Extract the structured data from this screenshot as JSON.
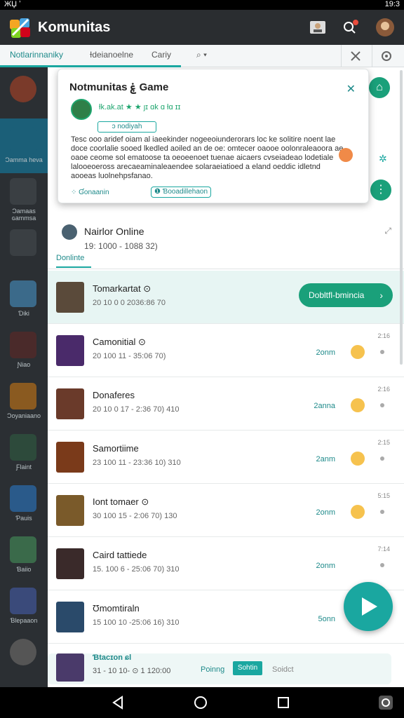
{
  "status_bar": {
    "left": "ЖЏ ʼ",
    "right": "19:3"
  },
  "app": {
    "title": "Komunitas"
  },
  "tabs": {
    "items": [
      "Notlarinnaniky",
      "Ɨdeianoelne",
      "Cariy"
    ]
  },
  "sidebar": {
    "items": [
      {
        "label": "",
        "icon": "community-shield-icon",
        "color": "#7a3a2a"
      },
      {
        "label": "Ɔamma heva",
        "icon": "chat-icon",
        "color": "#1b5f78"
      },
      {
        "label": "Ɔamaas ɢammsa",
        "icon": "headset-icon",
        "color": "#3a3f43"
      },
      {
        "label": "",
        "icon": "chat-bubble-icon",
        "color": "#3a3f43"
      },
      {
        "label": "Ɗiki",
        "icon": "game-thumb-icon",
        "color": "#3b6a8a"
      },
      {
        "label": "Ɲiao",
        "icon": "game-thumb-icon",
        "color": "#4a2a2a"
      },
      {
        "label": "Ɔoyaniaano",
        "icon": "game-thumb-icon",
        "color": "#8a5a20"
      },
      {
        "label": "Ƒlaint",
        "icon": "game-thumb-icon",
        "color": "#2d4a3b"
      },
      {
        "label": "Ƥauis",
        "icon": "game-thumb-icon",
        "color": "#2a5a8a"
      },
      {
        "label": "Ɓaiio",
        "icon": "game-thumb-icon",
        "color": "#3a6a4a"
      },
      {
        "label": "Ɓlepaaon",
        "icon": "game-thumb-icon",
        "color": "#3a4a7a"
      },
      {
        "label": "",
        "icon": "settings-icon",
        "color": "#555"
      }
    ]
  },
  "popup": {
    "title": "Notmunitas ۼ Game",
    "rating": "ƚk.ak.at ★ ★ ȷɪ ɑk ɑ ƚɑ ɪɪ",
    "badge": "ɔ nodiyah",
    "body": "Tesc ooo aridef oiam al iaeekinder nogeeoiunderorars loc ke solitire noent lae doce coorlalie sooed lkedled aoiled an de oe: omtecer oaooe oolonraleaoora ae oaoe ceome sol ematoose ta oeoeenoet tuenae aicaers cvseiadeao lodetiale lalooeoeross arecaeaminaleaendee solaraeiatioed a eland oeddic idletnd aooeas luolnehpsfanao.",
    "footer_left": "⁘ Ɠonaanin",
    "chip": "❶ Ɓooadillehaon"
  },
  "online": {
    "title": "Nairlor Online",
    "count": "19: 1000 - 1088 32)",
    "tab": "Donlinte"
  },
  "rows": [
    {
      "name": "Tomarkartat ⊙",
      "meta": "20 10 0 0 2036:86 70",
      "time": "",
      "stamp": "",
      "button": "Dobltfl-bmincia",
      "color": "#5a4a3a",
      "highlight": true
    },
    {
      "name": "Camonitial ⊙",
      "meta": "20 100 11 - 35:06 70)",
      "time": "2onm",
      "stamp": "2:16",
      "button": "",
      "color": "#4a2a6a",
      "highlight": false
    },
    {
      "name": "Donaferes",
      "meta": "20 10 0 17 - 2:36 70) 410",
      "time": "2anna",
      "stamp": "2:16",
      "button": "",
      "color": "#6a3a2a",
      "highlight": false
    },
    {
      "name": "Samortiime",
      "meta": "23 100 11 - 23:36 10) 310",
      "time": "2anm",
      "stamp": "2:15",
      "button": "",
      "color": "#7a3a1a",
      "highlight": false
    },
    {
      "name": "Iont tomaer ⊙",
      "meta": "30 100 15 - 2:06 70) 130",
      "time": "2onm",
      "stamp": "5:15",
      "button": "",
      "color": "#7a5a2a",
      "highlight": false
    },
    {
      "name": "Caird tattiede",
      "meta": "15. 100 6 - 25:06 70) 310",
      "time": "2onm",
      "stamp": "7:14",
      "button": "",
      "color": "#3a2a2a",
      "highlight": false
    },
    {
      "name": "Ʊmomtiraln",
      "meta": "15 100 10 -25:06 16) 310",
      "time": "5onn",
      "stamp": "",
      "button": "",
      "color": "#2a4a6a",
      "highlight": false
    }
  ],
  "bottom_card": {
    "title": "Ɓtaᴄɪon ɕl",
    "meta": "31 - 10   10-   ⊙   1 120:00",
    "link": "Poinng",
    "button": "Sohtin",
    "button2": "Soidct"
  },
  "nav": {
    "back": "back",
    "home": "home",
    "recents": "recents"
  }
}
